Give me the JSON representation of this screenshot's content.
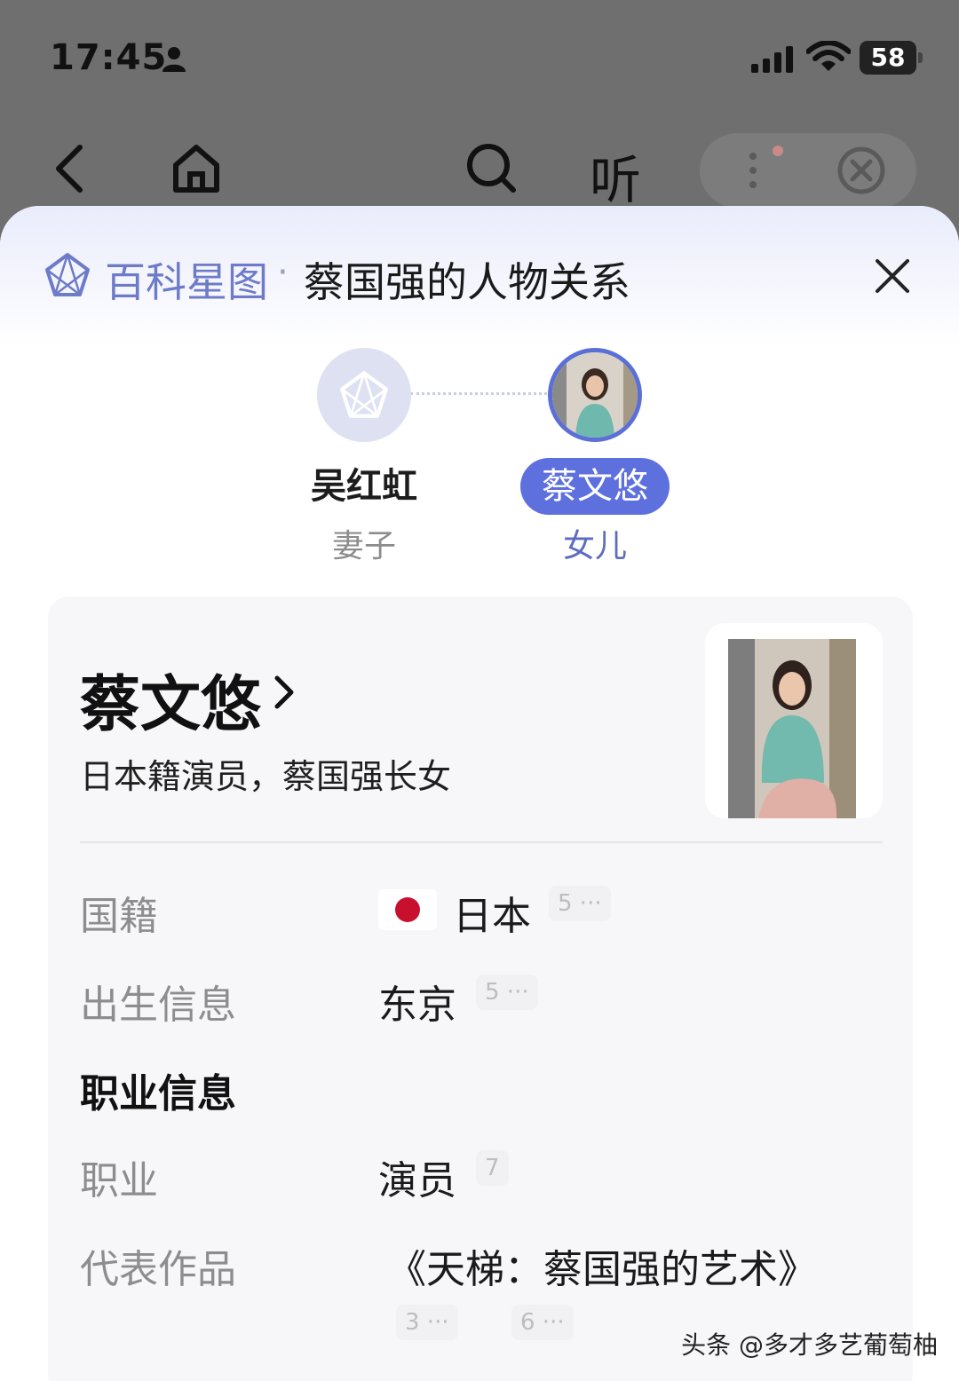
{
  "status_bar": {
    "time": "17:45",
    "battery": "58",
    "icons": [
      "person-icon",
      "signal-icon",
      "wifi-icon",
      "battery-icon"
    ]
  },
  "nav": {
    "icons": [
      "back-icon",
      "home-icon",
      "search-icon",
      "more-icon",
      "close-circle-icon"
    ],
    "listen_label": "听"
  },
  "sheet": {
    "brand": "百科星图",
    "separator": "·",
    "title": "蔡国强的人物关系",
    "close_icon": "close-icon"
  },
  "relations": [
    {
      "name": "吴红虹",
      "role": "妻子",
      "avatar": "placeholder-star-icon",
      "active": false
    },
    {
      "name": "蔡文悠",
      "role": "女儿",
      "avatar": "photo",
      "active": true
    }
  ],
  "card": {
    "name": "蔡文悠",
    "chevron": "chevron-right-icon",
    "description": "日本籍演员，蔡国强长女",
    "rows": [
      {
        "label": "国籍",
        "value": "日本",
        "ref": "5 ···",
        "flag": "japan-flag-icon"
      },
      {
        "label": "出生信息",
        "value": "东京",
        "ref": "5 ···"
      },
      {
        "label": "职业信息",
        "section": true
      },
      {
        "label": "职业",
        "value": "演员",
        "ref": "7"
      },
      {
        "label": "代表作品",
        "value": "《天梯：蔡国强的艺术》",
        "refs": [
          "3 ···",
          "6 ···"
        ]
      }
    ]
  },
  "watermark": "头条 @多才多艺葡萄柚",
  "colors": {
    "accent": "#5d70de",
    "brand_text": "#6d7bc8",
    "overlay": "#6f6f6f",
    "flag_red": "#c8102e"
  }
}
